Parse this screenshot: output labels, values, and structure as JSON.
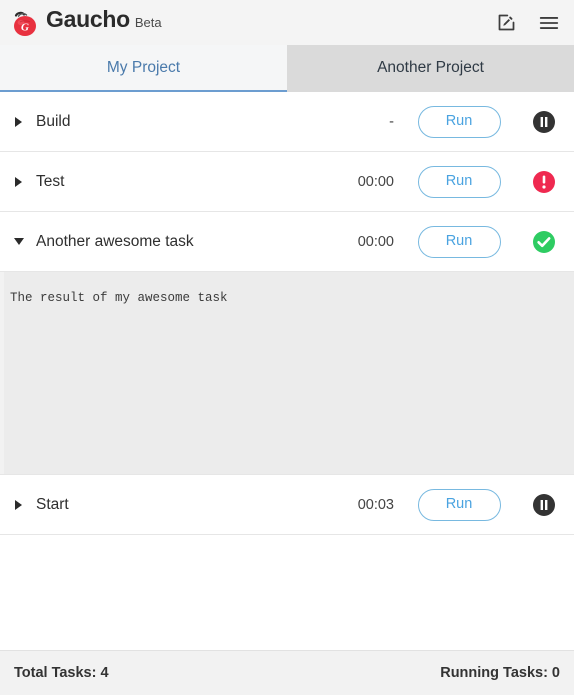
{
  "header": {
    "brand_name": "Gaucho",
    "brand_suffix": "Beta",
    "logo_icon": "tomato-logo-icon",
    "actions": [
      {
        "name": "edit-button",
        "icon": "edit-pencil-icon"
      },
      {
        "name": "menu-button",
        "icon": "hamburger-menu-icon"
      }
    ]
  },
  "tabs": [
    {
      "label": "My Project",
      "active": true
    },
    {
      "label": "Another Project",
      "active": false
    }
  ],
  "tasks": [
    {
      "name": "Build",
      "duration": "-",
      "run_label": "Run",
      "status_icon": "pause-circle-icon",
      "status": "idle",
      "expanded": false,
      "output": ""
    },
    {
      "name": "Test",
      "duration": "00:00",
      "run_label": "Run",
      "status_icon": "error-circle-icon",
      "status": "error",
      "expanded": false,
      "output": ""
    },
    {
      "name": "Another awesome task",
      "duration": "00:00",
      "run_label": "Run",
      "status_icon": "success-check-circle-icon",
      "status": "success",
      "expanded": true,
      "output": "The result of my awesome task"
    },
    {
      "name": "Start",
      "duration": "00:03",
      "run_label": "Run",
      "status_icon": "pause-circle-icon",
      "status": "idle",
      "expanded": false,
      "output": ""
    }
  ],
  "footer": {
    "total_tasks_label": "Total Tasks: 4",
    "running_tasks_label": "Running Tasks: 0"
  },
  "colors": {
    "accent_blue": "#4aa3e0",
    "tab_active_text": "#4a7aab",
    "status_error": "#ef2950",
    "status_success": "#2ecc62",
    "status_idle": "#333333",
    "logo_red": "#e8313f"
  }
}
